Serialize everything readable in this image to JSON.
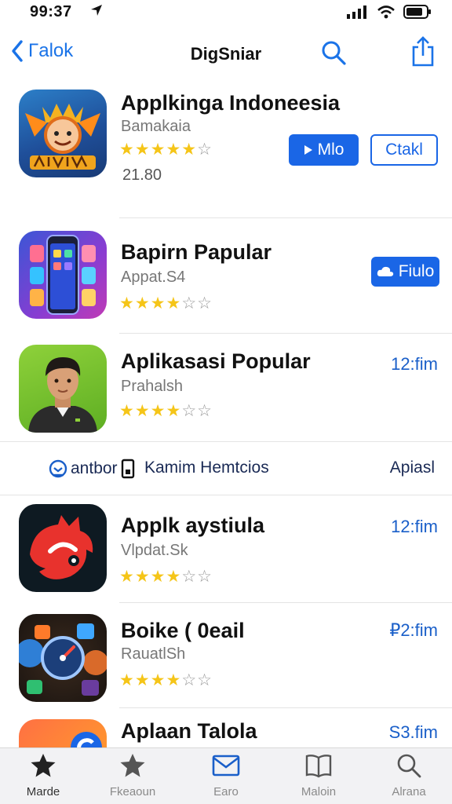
{
  "status_bar": {
    "time": "99:37"
  },
  "nav": {
    "back_label": "Γalok",
    "title": "DigSniar"
  },
  "apps": [
    {
      "name": "Applkinga Indoneesia",
      "subtitle": "Bamakaia",
      "rating": 4,
      "size": "21.80",
      "primary_button": "Mlo",
      "secondary_button": "Ctakl"
    },
    {
      "name": "Bapirn Papular",
      "subtitle": "Appat.S4",
      "rating": 3,
      "primary_button": "Fiulo"
    },
    {
      "name": "Aplikasasi Popular",
      "subtitle": "Prahalsh",
      "rating": 3,
      "right_text": "12:fim"
    },
    {
      "name": "Applk aystiula",
      "subtitle": "Vlpdat.Sk",
      "rating": 3,
      "right_text": "12:fim"
    },
    {
      "name": "Boike ( 0eail",
      "subtitle": "RauatlSh",
      "rating": 3,
      "right_text": "₽2:fim"
    },
    {
      "name": "Aplaan Talola",
      "right_text": "S3.fim"
    }
  ],
  "promo": {
    "left_label": "antbor",
    "mid_label": "Kamim Hemtcios",
    "right_label": "Apiasl"
  },
  "tabs": [
    {
      "label": "Marde",
      "icon": "star-filled-icon"
    },
    {
      "label": "Fkeaoun",
      "icon": "star-icon"
    },
    {
      "label": "Earo",
      "icon": "mail-icon"
    },
    {
      "label": "Maloin",
      "icon": "book-icon"
    },
    {
      "label": "Alrana",
      "icon": "search-icon"
    }
  ],
  "colors": {
    "accent": "#1a66e6",
    "star": "#f5c518",
    "link": "#1a5fc9"
  }
}
